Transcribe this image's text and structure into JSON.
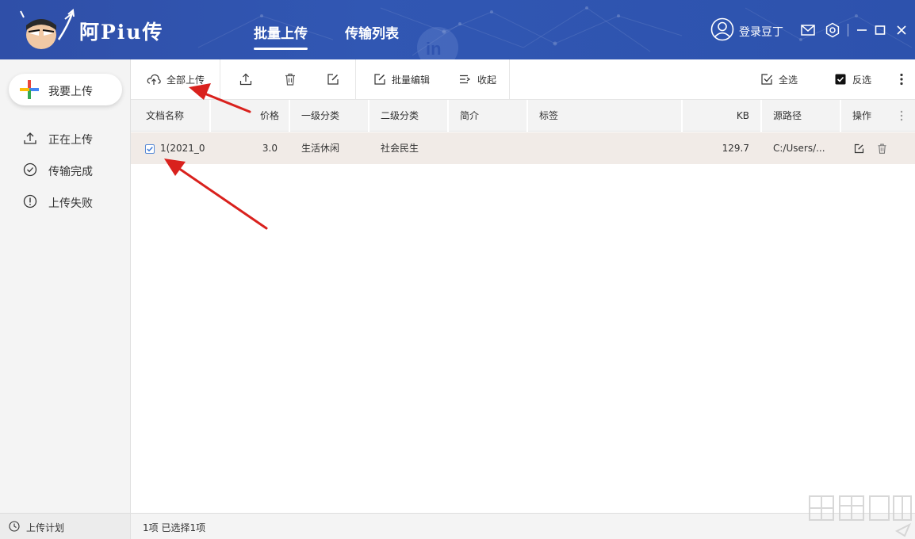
{
  "header": {
    "app_name": "阿Piu传",
    "tabs": [
      {
        "label": "批量上传",
        "active": true
      },
      {
        "label": "传输列表",
        "active": false
      }
    ],
    "login_label": "登录豆丁",
    "colors": {
      "bar": "#2f4fa8",
      "accent": "#d9211d"
    }
  },
  "sidebar": {
    "upload_button": "我要上传",
    "items": [
      {
        "label": "正在上传",
        "icon": "upload-icon"
      },
      {
        "label": "传输完成",
        "icon": "check-circle-icon"
      },
      {
        "label": "上传失败",
        "icon": "alert-circle-icon"
      }
    ],
    "bottom_label": "上传计划"
  },
  "toolbar": {
    "upload_all": "全部上传",
    "batch_edit": "批量编辑",
    "collapse": "收起",
    "select_all": "全选",
    "invert_select": "反选"
  },
  "table": {
    "columns": [
      "文档名称",
      "价格",
      "一级分类",
      "二级分类",
      "简介",
      "标签",
      "KB",
      "源路径",
      "操作"
    ],
    "rows": [
      {
        "checked": true,
        "name": "1(2021_0",
        "price": "3.0",
        "cat1": "生活休闲",
        "cat2": "社会民生",
        "intro": "",
        "tags": "",
        "kb": "129.7",
        "path": "C:/Users/..."
      }
    ]
  },
  "status": "1项 已选择1项"
}
